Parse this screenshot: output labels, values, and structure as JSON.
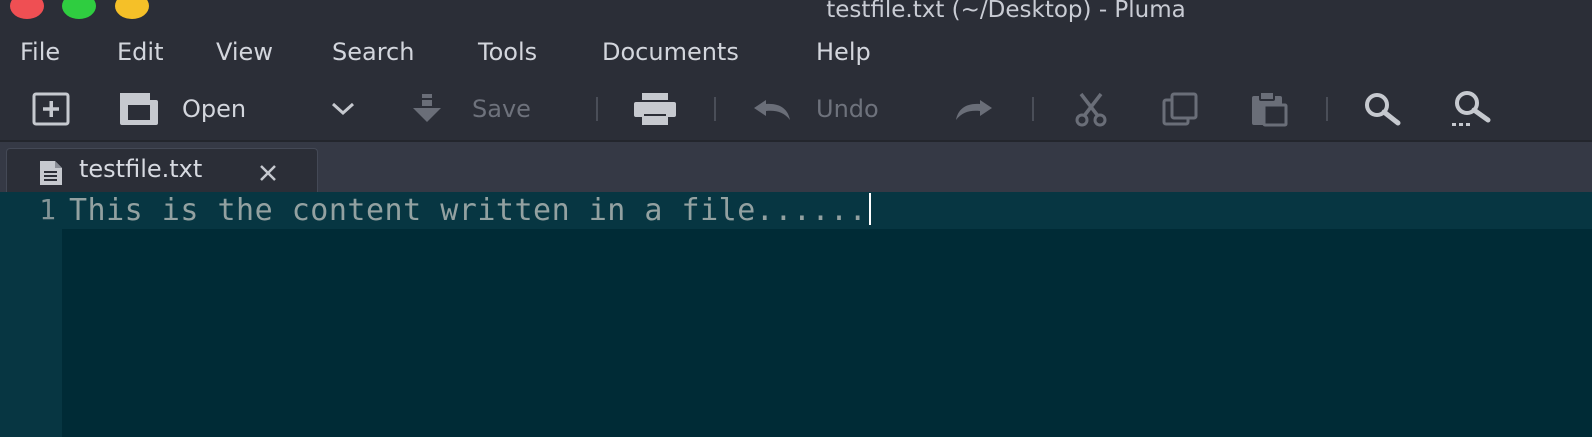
{
  "window": {
    "title": "testfile.txt (~/Desktop) - Pluma",
    "buttons": {
      "close_color": "#ef4f53",
      "maximize_color": "#2fcd40",
      "minimize_color": "#f5c028"
    }
  },
  "menubar": {
    "items": [
      {
        "label": "File"
      },
      {
        "label": "Edit"
      },
      {
        "label": "View"
      },
      {
        "label": "Search"
      },
      {
        "label": "Tools"
      },
      {
        "label": "Documents"
      },
      {
        "label": "Help"
      }
    ]
  },
  "toolbar": {
    "new_icon": "new-document-icon",
    "open_label": "Open",
    "save_label": "Save",
    "undo_label": "Undo",
    "print_icon": "print-icon",
    "redo_icon": "redo-icon",
    "cut_icon": "cut-icon",
    "copy_icon": "copy-icon",
    "paste_icon": "paste-icon",
    "find_icon": "search-icon",
    "replace_icon": "search-replace-icon"
  },
  "tabs": [
    {
      "label": "testfile.txt",
      "icon": "text-document-icon",
      "close_icon": "close-icon",
      "active": true
    }
  ],
  "editor": {
    "lines": [
      {
        "number": "1",
        "text": "This is the content written in a file......"
      }
    ],
    "colors": {
      "background": "#002b36",
      "current_line": "#073642",
      "text": "#93a1a1",
      "line_number": "#839496"
    }
  }
}
